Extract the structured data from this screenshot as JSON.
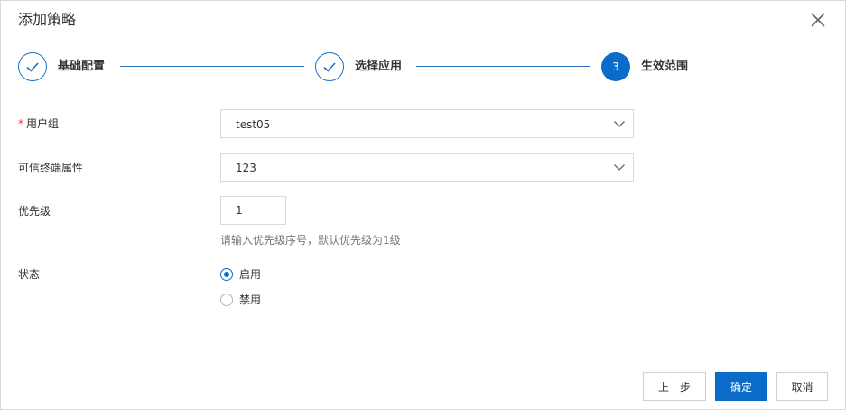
{
  "dialog": {
    "title": "添加策略"
  },
  "steps": [
    {
      "label": "基础配置",
      "status": "done"
    },
    {
      "label": "选择应用",
      "status": "done"
    },
    {
      "label": "生效范围",
      "status": "active",
      "number": "3"
    }
  ],
  "form": {
    "user_group": {
      "required_mark": "*",
      "label": "用户组",
      "value": "test05"
    },
    "terminal_attr": {
      "label": "可信终端属性",
      "value": "123"
    },
    "priority": {
      "label": "优先级",
      "value": "1",
      "hint": "请输入优先级序号，默认优先级为1级"
    },
    "status": {
      "label": "状态",
      "options": [
        {
          "label": "启用",
          "checked": true
        },
        {
          "label": "禁用",
          "checked": false
        }
      ]
    }
  },
  "buttons": {
    "prev": "上一步",
    "confirm": "确定",
    "cancel": "取消"
  },
  "colors": {
    "primary": "#0a6bc9",
    "border": "#d9d9d9",
    "required": "#e4393c"
  }
}
